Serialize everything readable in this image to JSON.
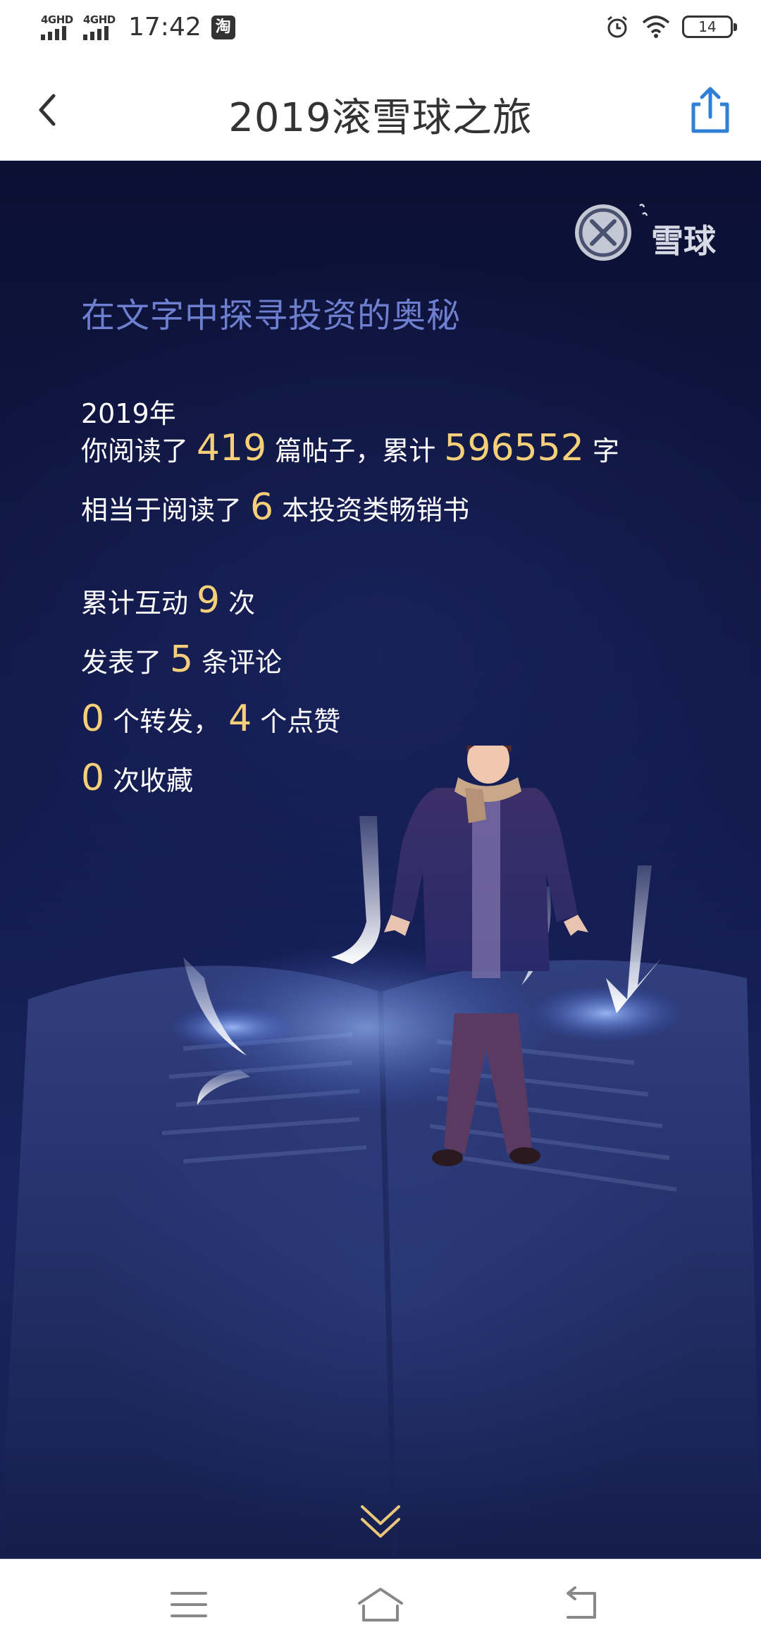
{
  "status_bar": {
    "signal1": "4GHD",
    "signal2": "4GHD",
    "time": "17:42",
    "app_badge": "淘",
    "battery": "14"
  },
  "header": {
    "title": "2019滚雪球之旅"
  },
  "logo": {
    "text": "雪球"
  },
  "main": {
    "heading": "在文字中探寻投资的奥秘",
    "year": "2019年",
    "reading": {
      "prefix": "你阅读了",
      "posts": "419",
      "mid": "篇帖子，累计",
      "words": "596552",
      "suffix": "字"
    },
    "books": {
      "prefix": "相当于阅读了",
      "count": "6",
      "suffix": "本投资类畅销书"
    },
    "interactions": {
      "prefix": "累计互动",
      "count": "9",
      "suffix": "次"
    },
    "comments": {
      "prefix": "发表了",
      "count": "5",
      "suffix": "条评论"
    },
    "shares_likes": {
      "shares": "0",
      "shares_label": "个转发，",
      "likes": "4",
      "likes_label": "个点赞"
    },
    "favorites": {
      "count": "0",
      "label": "次收藏"
    }
  },
  "colors": {
    "accent_number": "#f5cf7a",
    "heading": "#6e7fd0",
    "background_top": "#0b1033",
    "share_icon": "#2f7fd6"
  },
  "icons": {
    "back": "chevron-left-icon",
    "share": "share-icon",
    "scroll": "double-chevron-down-icon",
    "nav_menu": "menu-icon",
    "nav_home": "home-icon",
    "nav_back": "return-icon"
  }
}
